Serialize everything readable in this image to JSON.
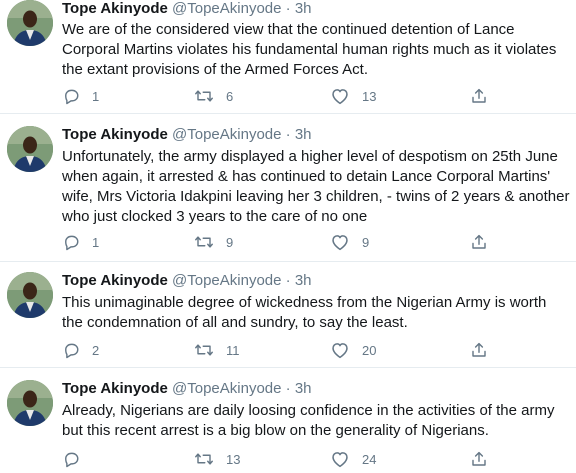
{
  "tweets": [
    {
      "name": "Tope Akinyode",
      "handle": "@TopeAkinyode",
      "separator": "·",
      "time": "3h",
      "lines": [
        "We are of the considered view that the continued detention of Lance",
        "Corporal Martins violates his fundamental human rights much as it violates",
        "the extant provisions of the Armed Forces Act."
      ],
      "replies": "1",
      "retweets": "6",
      "likes": "13"
    },
    {
      "name": "Tope Akinyode",
      "handle": "@TopeAkinyode",
      "separator": "·",
      "time": "3h",
      "lines": [
        "Unfortunately, the army displayed a higher level of despotism on 25th June",
        "when again, it arrested & has continued to detain Lance Corporal Martins'",
        "wife, Mrs Victoria Idakpini leaving her 3 children, - twins of 2 years & another",
        "who just clocked 3 years to the care of no one"
      ],
      "replies": "1",
      "retweets": "9",
      "likes": "9"
    },
    {
      "name": "Tope Akinyode",
      "handle": "@TopeAkinyode",
      "separator": "·",
      "time": "3h",
      "lines": [
        "This unimaginable degree of wickedness from the Nigerian Army is worth",
        "the condemnation of all and sundry, to say the least."
      ],
      "replies": "2",
      "retweets": "11",
      "likes": "20"
    },
    {
      "name": "Tope Akinyode",
      "handle": "@TopeAkinyode",
      "separator": "·",
      "time": "3h",
      "lines": [
        "Already, Nigerians are daily loosing confidence in the activities of the army",
        "but this recent arrest is a big blow on the generality of Nigerians."
      ],
      "replies": "",
      "retweets": "13",
      "likes": "24"
    }
  ],
  "icons": {
    "reply": "reply-icon",
    "retweet": "retweet-icon",
    "like": "heart-icon",
    "share": "share-icon"
  },
  "colors": {
    "text": "#14171a",
    "muted": "#657786",
    "divider": "#e6ecf0"
  }
}
